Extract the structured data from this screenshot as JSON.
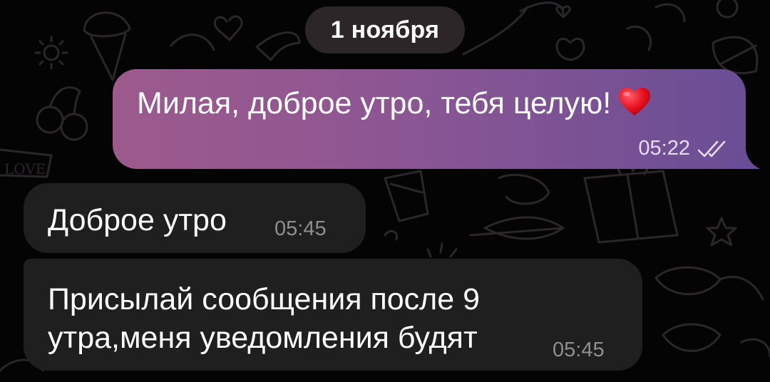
{
  "chat": {
    "date_separator": "1 ноября",
    "background_pattern": "doodle-love-pattern",
    "messages": [
      {
        "direction": "outgoing",
        "text": "Милая, доброе утро, тебя целую!",
        "emoji": "❤️",
        "time": "05:22",
        "status": "read-double-check"
      },
      {
        "direction": "incoming",
        "text": "Доброе утро",
        "time": "05:45"
      },
      {
        "direction": "incoming",
        "text": "Присылай сообщения после 9 утра,меня уведомления будят",
        "time": "05:45"
      }
    ]
  },
  "colors": {
    "background": "#050405",
    "pattern_stroke": "#2a262a",
    "outgoing_gradient_start": "#9d5a8c",
    "outgoing_gradient_end": "#6a4e95",
    "incoming_bubble": "#1f1f1f",
    "date_pill": "#2d2628",
    "incoming_time": "#8f8f8f"
  }
}
